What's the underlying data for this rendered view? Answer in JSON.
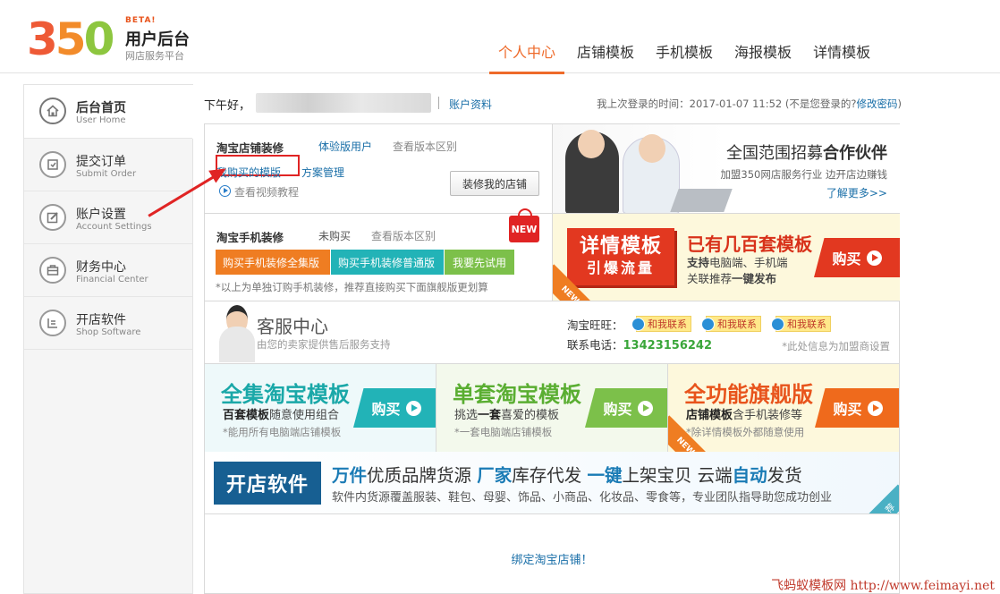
{
  "header": {
    "logo_number": "350",
    "logo_beta": "BETA!",
    "logo_title": "用户后台",
    "logo_subtitle": "网店服务平台",
    "nav": [
      {
        "label": "个人中心",
        "active": true
      },
      {
        "label": "店铺模板",
        "active": false
      },
      {
        "label": "手机模板",
        "active": false
      },
      {
        "label": "海报模板",
        "active": false
      },
      {
        "label": "详情模板",
        "active": false
      }
    ]
  },
  "sidebar": {
    "items": [
      {
        "cn": "后台首页",
        "en": "User Home",
        "icon": "home-icon",
        "active": true
      },
      {
        "cn": "提交订单",
        "en": "Submit Order",
        "icon": "order-icon",
        "active": false
      },
      {
        "cn": "账户设置",
        "en": "Account Settings",
        "icon": "edit-icon",
        "active": false
      },
      {
        "cn": "财务中心",
        "en": "Financial Center",
        "icon": "wallet-icon",
        "active": false
      },
      {
        "cn": "开店软件",
        "en": "Shop Software",
        "icon": "shop-icon",
        "active": false
      }
    ]
  },
  "welcome": {
    "greeting": "下午好，",
    "account_link": "账户资料",
    "last_login_prefix": "我上次登录的时间：2017-01-07 11:52 (不是您登录的?",
    "change_password": "修改密码",
    "last_login_suffix": ")"
  },
  "shop_decor": {
    "title": "淘宝店铺装修",
    "trial_user": "体验版用户",
    "compare": "查看版本区别",
    "my_templates": "我购买的模版",
    "plan_manage": "方案管理",
    "video": "查看视频教程",
    "decorate_button": "装修我的店铺"
  },
  "partner": {
    "title_plain": "全国范围招募",
    "title_bold": "合作伙伴",
    "subtitle": "加盟350网店服务行业  边开店边赚钱",
    "more": "了解更多>>"
  },
  "mobile_decor": {
    "title": "淘宝手机装修",
    "status": "未购买",
    "compare": "查看版本区别",
    "new_badge": "NEW",
    "btn_full": "购买手机装修全集版",
    "btn_normal": "购买手机装修普通版",
    "btn_trial": "我要先试用",
    "note": "*以上为单独订购手机装修，推荐直接购买下面旗舰版更划算"
  },
  "detail_promo": {
    "box_line1": "详情模板",
    "box_line2": "引爆流量",
    "heading": "已有几百套模板",
    "line1_bold": "支持",
    "line1_rest": "电脑端、手机端",
    "line2_pre": "关联推荐",
    "line2_bold": "一键发布",
    "buy": "购买",
    "corner": "NEW"
  },
  "service": {
    "title": "客服中心",
    "subtitle": "由您的卖家提供售后服务支持",
    "wangwang_label": "淘宝旺旺：",
    "contact_label": "和我联系",
    "tel_label": "联系电话：",
    "tel_number": "13423156242",
    "note": "*此处信息为加盟商设置"
  },
  "template_cards": [
    {
      "title": "全集淘宝模板",
      "desc_bold": "百套模板",
      "desc_rest": "随意使用组合",
      "note": "*能用所有电脑端店铺模板",
      "buy": "购买",
      "title_color": "#1aa8a8",
      "btn_color": "#22b3b7",
      "bg": "#eef9fa"
    },
    {
      "title": "单套淘宝模板",
      "desc_pre": "挑选",
      "desc_bold": "一套",
      "desc_rest": "喜爱的模板",
      "note": "*一套电脑端店铺模板",
      "buy": "购买",
      "title_color": "#5aae32",
      "btn_color": "#7cc04a",
      "bg": "#f3f9ec"
    },
    {
      "title": "全功能旗舰版",
      "desc_bold": "店铺模板",
      "desc_rest": "含手机装修等",
      "note": "*除详情模板外都随意使用",
      "buy": "购买",
      "title_color": "#e8541c",
      "btn_color": "#ef6a1c",
      "bg": "#fdf8dc",
      "corner": "NEW"
    }
  ],
  "software_banner": {
    "badge": "开店软件",
    "h_1": "万件",
    "h_2": "优质品牌货源  ",
    "h_3": "厂家",
    "h_4": "库存代发  ",
    "h_5": "一键",
    "h_6": "上架宝贝  云端",
    "h_7": "自动",
    "h_8": "发货",
    "sub": "软件内货源覆盖服装、鞋包、母婴、饰品、小商品、化妆品、零食等，专业团队指导助您成功创业",
    "corner": "荐"
  },
  "bind_shop": "绑定淘宝店铺！",
  "watermark": "飞蚂蚁模板网 http://www.feimayi.net",
  "colors": {
    "accent": "#ee6a2a",
    "link": "#1a6fa8",
    "highlight": "#e02424"
  }
}
